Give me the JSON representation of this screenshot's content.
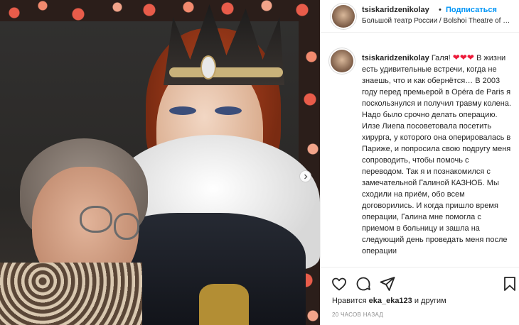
{
  "post": {
    "username": "tsiskaridzenikolay",
    "separator": "•",
    "follow_label": "Подписаться",
    "location": "Большой театр России / Bolshoi Theatre of R...",
    "photo_alt": "Post photo"
  },
  "caption": {
    "username": "tsiskaridzenikolay",
    "lead": "Галя!",
    "hearts": "❤❤❤",
    "text": "В жизни есть удивительные встречи, когда не знаешь, что и как обернётся… В 2003 году перед премьерой в Opéra de Paris я поскользнулся и получил травму колена. Надо было срочно делать операцию. Илзе Лиепа посоветовала посетить хирурга, у которого она оперировалась в Париже, и попросила свою подругу меня сопроводить, чтобы помочь с переводом. Так я и познакомился с замечательной Галиной КАЗНОБ. Мы сходили на приём, обо всем договорились. И когда пришло время операции, Галина мне помогла с приемом в больницу и зашла на следующий день проведать меня после операции"
  },
  "likes": {
    "prefix": "Нравится",
    "user": "eka_eka123",
    "suffix": "и другим"
  },
  "timestamp": "20 часов назад",
  "icons": {
    "like": "heart-icon",
    "comment": "comment-icon",
    "share": "paper-plane-icon",
    "save": "bookmark-icon",
    "carousel_next": "chevron-right-icon"
  },
  "colors": {
    "follow": "#0095f6",
    "heart": "#ed1c3b",
    "muted": "#8e8e8e"
  }
}
